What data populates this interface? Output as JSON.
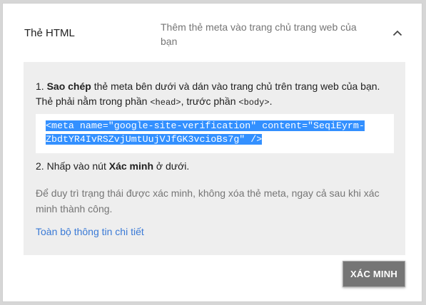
{
  "method": {
    "title": "Thẻ HTML",
    "description": "Thêm thẻ meta vào trang chủ trang web của bạn"
  },
  "step1": {
    "number": "1.",
    "bold": "Sao chép",
    "text_a": " thẻ meta bên dưới và dán vào trang chủ trên trang web của bạn. Thẻ phải nằm trong phần ",
    "head_tag": "<head>",
    "text_b": ", trước phần ",
    "body_tag": "<body>",
    "text_c": "."
  },
  "meta_tag": {
    "line1": "<meta name=\"google-site-verification\" content=\"SeqiEyrm-",
    "line2": "ZbdtYR4IvRSZvjUmtUujVJfGK3vcioBs7g\" />"
  },
  "step2": {
    "number": "2.",
    "text_a": " Nhấp vào nút ",
    "bold": "Xác minh",
    "text_b": " ở dưới."
  },
  "note": "Để duy trì trạng thái được xác minh, không xóa thẻ meta, ngay cả sau khi xác minh thành công.",
  "details_link": "Toàn bộ thông tin chi tiết",
  "verify_button": "XÁC MINH",
  "icons": {
    "collapse": "chevron-up-icon"
  },
  "colors": {
    "selection": "#3390ff",
    "link": "#3a7ad6",
    "button": "#757575",
    "panel": "#eeeeee"
  }
}
